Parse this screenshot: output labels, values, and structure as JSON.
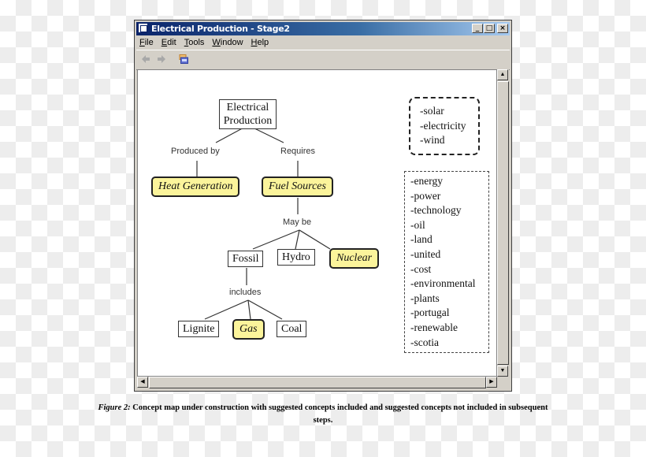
{
  "window": {
    "title": "Electrical Production - Stage2",
    "controls": {
      "minimize": "_",
      "maximize": "□",
      "close": "×"
    }
  },
  "menu": [
    "File",
    "Edit",
    "Tools",
    "Window",
    "Help"
  ],
  "toolbar": {
    "icons": [
      "back-arrow-icon",
      "forward-arrow-icon",
      "concept-map-icon"
    ]
  },
  "concept_map": {
    "nodes": {
      "electrical_production": "Electrical\nProduction",
      "heat_generation": "Heat Generation",
      "fuel_sources": "Fuel Sources",
      "fossil": "Fossil",
      "hydro": "Hydro",
      "nuclear": "Nuclear",
      "lignite": "Lignite",
      "gas": "Gas",
      "coal": "Coal"
    },
    "links": {
      "produced_by": "Produced by",
      "requires": "Requires",
      "may_be": "May be",
      "includes": "includes"
    },
    "suggested_included": [
      "-solar",
      "-electricity",
      "-wind"
    ],
    "suggested_not_included": [
      "-energy",
      "-power",
      "-technology",
      "-oil",
      "-land",
      "-united",
      "-cost",
      "-environmental",
      "-plants",
      "-portugal",
      "-renewable",
      "-scotia"
    ],
    "colors": {
      "suggested_fill": "#fbf49b",
      "title_bar": "#0a246a"
    }
  },
  "caption": {
    "label": "Figure 2:",
    "text": " Concept map under construction with suggested concepts included and suggested concepts not included in subsequent steps."
  }
}
